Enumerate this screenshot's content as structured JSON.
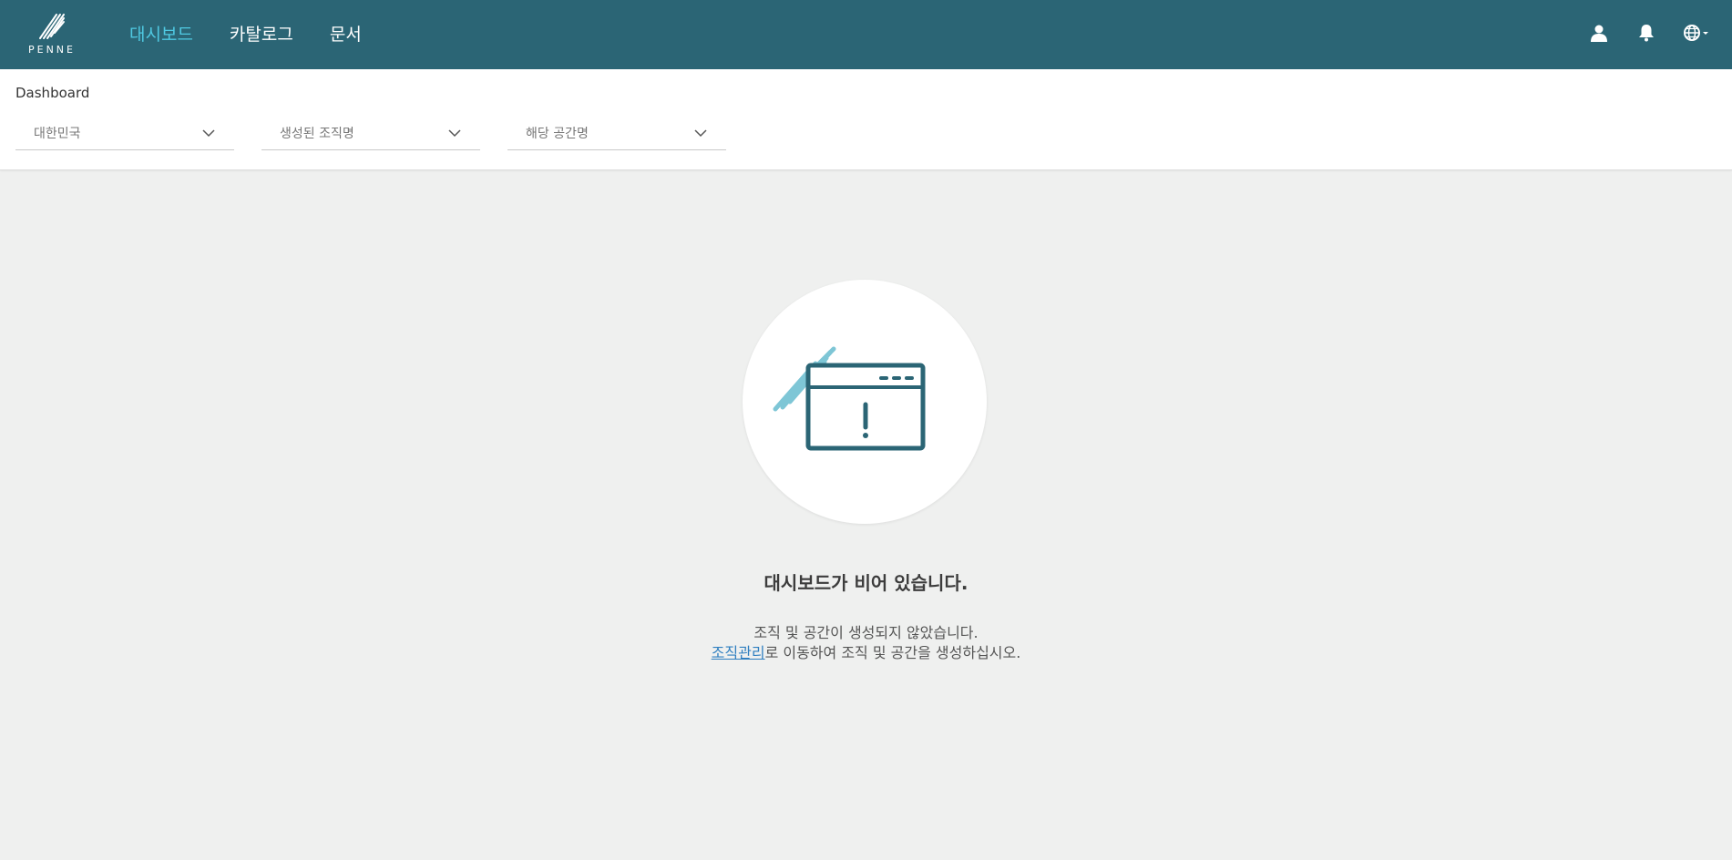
{
  "brand": {
    "logo_text": "PENNE"
  },
  "nav": {
    "items": [
      {
        "label": "대시보드",
        "active": true
      },
      {
        "label": "카탈로그",
        "active": false
      },
      {
        "label": "문서",
        "active": false
      }
    ]
  },
  "top_icons": [
    "user-icon",
    "bell-icon",
    "globe-icon"
  ],
  "page": {
    "title": "Dashboard"
  },
  "filters": {
    "country": "대한민국",
    "organization": "생성된 조직명",
    "space": "해당 공간명"
  },
  "empty_state": {
    "title": "대시보드가 비어 있습니다.",
    "line1": "조직 및 공간이 생성되지 않았습니다.",
    "link_text": "조직관리",
    "line2_rest": "로 이동하여 조직 및 공간을 생성하십시오."
  },
  "colors": {
    "header_bg": "#2b6575",
    "nav_active": "#4fc9e2",
    "page_bg": "#eff0ef",
    "illustration_dark": "#2b6575",
    "illustration_light": "#7ec6d6",
    "link": "#2f7fc0"
  }
}
